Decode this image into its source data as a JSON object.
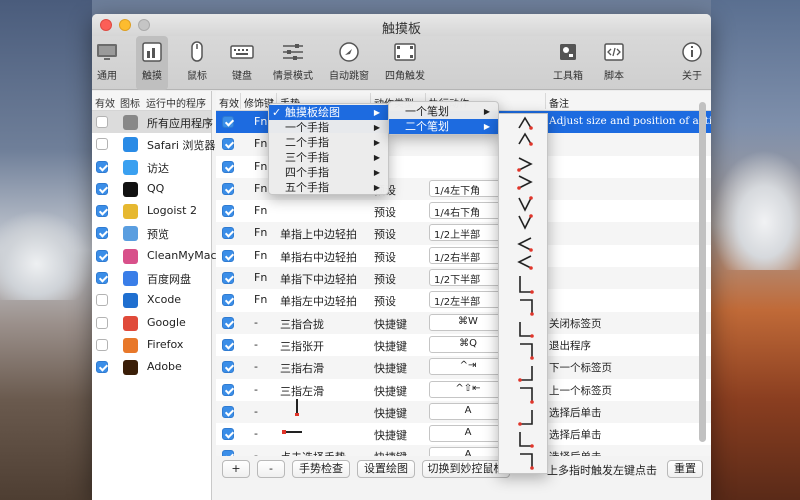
{
  "window": {
    "title": "触摸板"
  },
  "toolbar": {
    "items": [
      {
        "label": "通用",
        "icon": "monitor-icon"
      },
      {
        "label": "触摸",
        "icon": "trackpad-icon"
      },
      {
        "label": "鼠标",
        "icon": "mouse-icon"
      },
      {
        "label": "键盘",
        "icon": "keyboard-icon"
      },
      {
        "label": "情景模式",
        "icon": "sliders-icon"
      },
      {
        "label": "自动跳窗",
        "icon": "compass-icon"
      },
      {
        "label": "四角触发",
        "icon": "corners-icon"
      },
      {
        "label": "工具箱",
        "icon": "toolbox-icon"
      },
      {
        "label": "脚本",
        "icon": "script-icon"
      },
      {
        "label": "关于",
        "icon": "info-icon"
      }
    ]
  },
  "apps": {
    "headers": [
      "有效",
      "图标",
      "运行中的程序"
    ],
    "rows": [
      {
        "name": "所有应用程序",
        "checked": false,
        "icon": "all-apps-icon",
        "color": "#888888"
      },
      {
        "name": "Safari 浏览器",
        "checked": false,
        "icon": "safari-icon",
        "color": "#2a8be6"
      },
      {
        "name": "访达",
        "checked": true,
        "icon": "finder-icon",
        "color": "#3aa0f0"
      },
      {
        "name": "QQ",
        "checked": true,
        "icon": "qq-icon",
        "color": "#111111"
      },
      {
        "name": "Logoist 2",
        "checked": true,
        "icon": "logoist-icon",
        "color": "#e6b830"
      },
      {
        "name": "预览",
        "checked": true,
        "icon": "preview-icon",
        "color": "#5a9ee0"
      },
      {
        "name": "CleanMyMac",
        "checked": true,
        "icon": "cleanmymac-icon",
        "color": "#d8508a"
      },
      {
        "name": "百度网盘",
        "checked": true,
        "icon": "baidu-netdisk-icon",
        "color": "#3a7ee8"
      },
      {
        "name": "Xcode",
        "checked": false,
        "icon": "xcode-icon",
        "color": "#1f6fd0"
      },
      {
        "name": "Google",
        "checked": false,
        "icon": "chrome-icon",
        "color": "#e04a3a"
      },
      {
        "name": "Firefox",
        "checked": false,
        "icon": "firefox-icon",
        "color": "#e8782a"
      },
      {
        "name": "Adobe",
        "checked": true,
        "icon": "illustrator-icon",
        "color": "#3a1e08"
      }
    ]
  },
  "gestures": {
    "headers": [
      "有效",
      "修饰键",
      "手势",
      "动作类型",
      "执行动作",
      "备注"
    ],
    "rows": [
      {
        "mod": "Fn",
        "gesture": "",
        "type": "",
        "action": "",
        "note": "Adjust size and position of active",
        "selected": true
      },
      {
        "mod": "Fn",
        "gesture": "",
        "type": "",
        "action": "",
        "note": ""
      },
      {
        "mod": "Fn",
        "gesture": "",
        "type": "",
        "action": "",
        "note": ""
      },
      {
        "mod": "Fn",
        "gesture": "",
        "type": "预设",
        "action": "1/4左下角",
        "note": ""
      },
      {
        "mod": "Fn",
        "gesture": "",
        "type": "预设",
        "action": "1/4右下角",
        "note": ""
      },
      {
        "mod": "Fn",
        "gesture": "单指上中边轻拍",
        "type": "预设",
        "action": "1/2上半部",
        "note": ""
      },
      {
        "mod": "Fn",
        "gesture": "单指右中边轻拍",
        "type": "预设",
        "action": "1/2右半部",
        "note": ""
      },
      {
        "mod": "Fn",
        "gesture": "单指下中边轻拍",
        "type": "预设",
        "action": "1/2下半部",
        "note": ""
      },
      {
        "mod": "Fn",
        "gesture": "单指左中边轻拍",
        "type": "预设",
        "action": "1/2左半部",
        "note": ""
      },
      {
        "mod": "-",
        "gesture": "三指合拢",
        "type": "快捷键",
        "action": "⌘W",
        "note": "关闭标签页"
      },
      {
        "mod": "-",
        "gesture": "三指张开",
        "type": "快捷键",
        "action": "⌘Q",
        "note": "退出程序"
      },
      {
        "mod": "-",
        "gesture": "三指右滑",
        "type": "快捷键",
        "action": "^⇥",
        "note": "下一个标签页"
      },
      {
        "mod": "-",
        "gesture": "三指左滑",
        "type": "快捷键",
        "action": "^⇧⇤",
        "note": "上一个标签页"
      },
      {
        "mod": "-",
        "gesture": "",
        "type": "快捷键",
        "action": "A",
        "note": "选择后单击"
      },
      {
        "mod": "-",
        "gesture": "",
        "type": "快捷键",
        "action": "A",
        "note": "选择后单击"
      },
      {
        "mod": "-",
        "gesture": "点击选择手势",
        "type": "快捷键",
        "action": "A",
        "note": "选择后单击"
      },
      {
        "mod": "-",
        "gesture": "点击选择手势",
        "type": "快捷键",
        "action": "A",
        "note": "选择后单击"
      }
    ]
  },
  "menu1": {
    "items": [
      {
        "label": "触摸板绘图",
        "checked": true,
        "highlighted": true
      },
      {
        "label": "一个手指"
      },
      {
        "label": "二个手指"
      },
      {
        "label": "三个手指"
      },
      {
        "label": "四个手指"
      },
      {
        "label": "五个手指"
      }
    ]
  },
  "menu2": {
    "items": [
      {
        "label": "一个笔划"
      },
      {
        "label": "二个笔划",
        "highlighted": true
      }
    ]
  },
  "buttons": {
    "add": "+",
    "remove": "-",
    "check": "手势检查",
    "draw": "设置绘图",
    "switch": "切换到妙控鼠标",
    "multi": "上多指时触发左键点击",
    "reset": "重置"
  },
  "colors": {
    "accent": "#1d6be0",
    "checkbox": "#3b8ee8"
  }
}
